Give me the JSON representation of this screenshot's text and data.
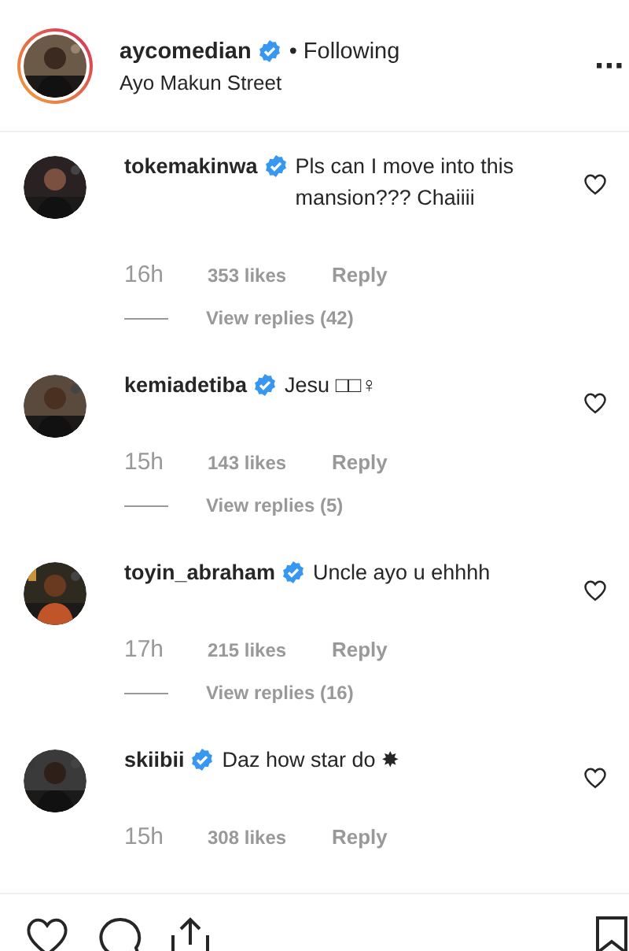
{
  "header": {
    "username": "aycomedian",
    "verified": true,
    "follow_status": "• Following",
    "location": "Ayo Makun Street",
    "more": "···"
  },
  "comments": [
    {
      "username": "tokemakinwa",
      "verified": true,
      "text": "Pls can I move into this mansion??? Chaiiii",
      "time": "16h",
      "likes": "353 likes",
      "reply": "Reply",
      "view_replies": "View replies (42)"
    },
    {
      "username": "kemiadetiba",
      "verified": true,
      "text": "Jesu □□♀",
      "time": "15h",
      "likes": "143 likes",
      "reply": "Reply",
      "view_replies": "View replies (5)"
    },
    {
      "username": "toyin_abraham",
      "verified": true,
      "text": "Uncle ayo u ehhhh",
      "time": "17h",
      "likes": "215 likes",
      "reply": "Reply",
      "view_replies": "View replies (16)"
    },
    {
      "username": "skiibii",
      "verified": true,
      "text": "Daz how star do ✸",
      "time": "15h",
      "likes": "308 likes",
      "reply": "Reply"
    }
  ]
}
